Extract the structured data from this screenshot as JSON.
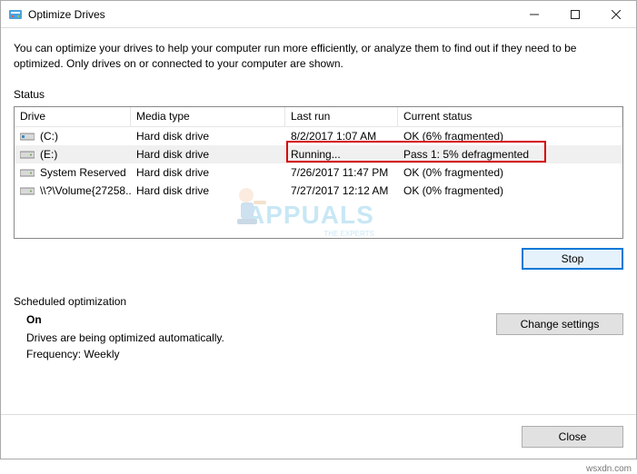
{
  "window": {
    "title": "Optimize Drives"
  },
  "description": "You can optimize your drives to help your computer run more efficiently, or analyze them to find out if they need to be optimized. Only drives on or connected to your computer are shown.",
  "status_label": "Status",
  "columns": {
    "drive": "Drive",
    "media": "Media type",
    "lastrun": "Last run",
    "status": "Current status"
  },
  "drives": [
    {
      "icon": "drive-c",
      "name": "(C:)",
      "media": "Hard disk drive",
      "lastrun": "8/2/2017 1:07 AM",
      "status": "OK (6% fragmented)"
    },
    {
      "icon": "drive-hdd",
      "name": "(E:)",
      "media": "Hard disk drive",
      "lastrun": "Running...",
      "status": "Pass 1: 5% defragmented"
    },
    {
      "icon": "drive-hdd",
      "name": "System Reserved",
      "media": "Hard disk drive",
      "lastrun": "7/26/2017 11:47 PM",
      "status": "OK (0% fragmented)"
    },
    {
      "icon": "drive-hdd",
      "name": "\\\\?\\Volume{27258...",
      "media": "Hard disk drive",
      "lastrun": "7/27/2017 12:12 AM",
      "status": "OK (0% fragmented)"
    }
  ],
  "buttons": {
    "stop": "Stop",
    "change_settings": "Change settings",
    "close": "Close"
  },
  "schedule": {
    "label": "Scheduled optimization",
    "state": "On",
    "line1": "Drives are being optimized automatically.",
    "line2": "Frequency: Weekly"
  },
  "watermark": {
    "brand": "APPUALS",
    "sub": "THE EXPERTS"
  },
  "attribution": "wsxdn.com"
}
